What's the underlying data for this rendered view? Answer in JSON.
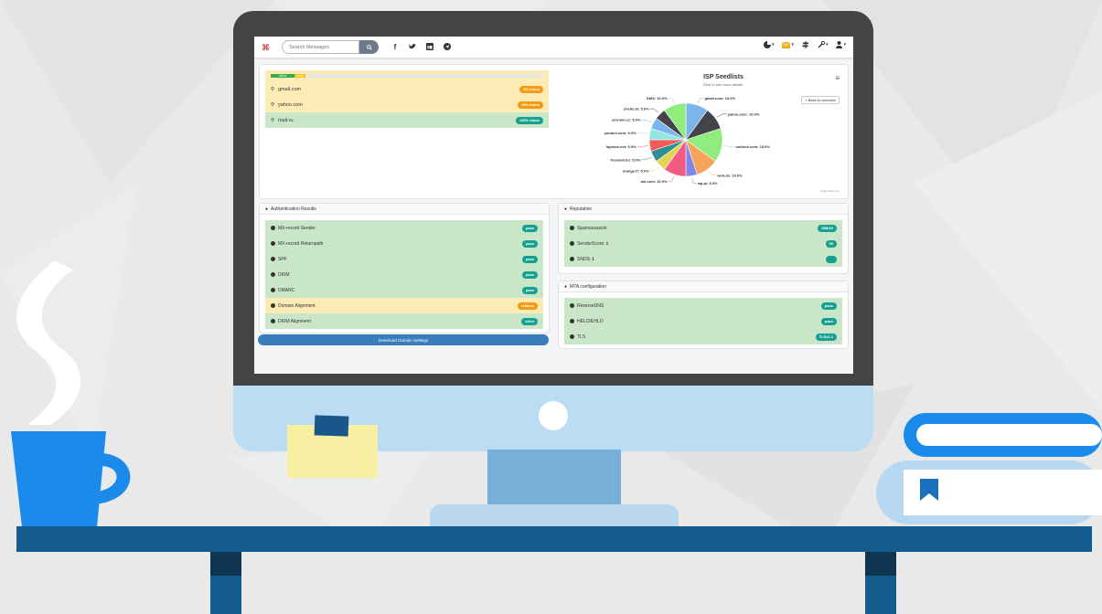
{
  "topbar": {
    "search_placeholder": "Search Messages",
    "social_icons": [
      "facebook-icon",
      "twitter-icon",
      "linkedin-icon",
      "telegram-icon"
    ],
    "right_icons": [
      "chart-icon",
      "mail-icon",
      "signpost-icon",
      "wrench-icon",
      "user-icon"
    ]
  },
  "inbox_panel": {
    "progress": {
      "inbox_label": "Inbox",
      "spam_label": "Junk"
    },
    "isps": [
      {
        "name": "gmail.com",
        "status": "0% Inbox",
        "state": "warn"
      },
      {
        "name": "yahoo.com",
        "status": "33% Inbox",
        "state": "warn"
      },
      {
        "name": "mail.ru",
        "status": "100% Inbox",
        "state": "ok"
      }
    ]
  },
  "chart": {
    "menu_icon": "hamburger-icon",
    "back_label": "« Back to overview",
    "credits": "Highcharts.com"
  },
  "chart_data": {
    "type": "pie",
    "title": "ISP Seedlists",
    "subtitle": "Click to see more details.",
    "slices": [
      {
        "name": "gmail.com",
        "value": 10.0,
        "color": "#7cb5ec"
      },
      {
        "name": "yahoo.com",
        "value": 10.0,
        "color": "#434348"
      },
      {
        "name": "outlook.com",
        "value": 15.0,
        "color": "#90ed7d"
      },
      {
        "name": "web.de",
        "value": 10.0,
        "color": "#f7a35c"
      },
      {
        "name": "wp.pl",
        "value": 5.0,
        "color": "#8085e9"
      },
      {
        "name": "aol.com",
        "value": 10.0,
        "color": "#f15c80"
      },
      {
        "name": "orange.fr",
        "value": 5.0,
        "color": "#e4d354"
      },
      {
        "name": "freemail.hu",
        "value": 5.0,
        "color": "#2b908f"
      },
      {
        "name": "laposte.net",
        "value": 5.0,
        "color": "#f45b5b"
      },
      {
        "name": "yandex.com",
        "value": 5.0,
        "color": "#91e8e1"
      },
      {
        "name": "seznam.cz",
        "value": 5.0,
        "color": "#7cb5ec"
      },
      {
        "name": "chello.at",
        "value": 5.0,
        "color": "#434348"
      },
      {
        "name": "GMX",
        "value": 10.0,
        "color": "#90ed7d"
      }
    ]
  },
  "auth": {
    "title": "Authentication Results",
    "rows": [
      {
        "label": "MX-record Sender",
        "status": "pass",
        "state": "ok"
      },
      {
        "label": "MX-record Returnpath",
        "status": "pass",
        "state": "ok"
      },
      {
        "label": "SPF",
        "status": "pass",
        "state": "ok"
      },
      {
        "label": "DKIM",
        "status": "pass",
        "state": "ok"
      },
      {
        "label": "DMARC",
        "status": "pass",
        "state": "ok"
      },
      {
        "label": "Domain Alignment",
        "status": "relaxed",
        "state": "warn"
      },
      {
        "label": "DKIM Alignment",
        "status": "strict",
        "state": "ok"
      }
    ],
    "download_label": "Download Domain Settings"
  },
  "reputation": {
    "title": "Reputation",
    "rows": [
      {
        "label": "Spamassassin",
        "status": "INBOX"
      },
      {
        "label": "SenderScore: ℹ",
        "status": "99"
      },
      {
        "label": "SNDS: ℹ",
        "status": ""
      }
    ]
  },
  "mta": {
    "title": "MTA configuration",
    "rows": [
      {
        "label": "ReverseDNS",
        "status": "pass"
      },
      {
        "label": "HELO/EHLO",
        "status": "pass"
      },
      {
        "label": "TLS",
        "status": "TLSv1.2"
      }
    ]
  },
  "colors": {
    "accent": "#3a7dbd",
    "ok_row": "#c9e6c9",
    "warn_row": "#fcebb5",
    "teal_pill": "#16a090",
    "orange_pill": "#f39c12",
    "desk": "#155c8e",
    "monitor": "#444446"
  }
}
